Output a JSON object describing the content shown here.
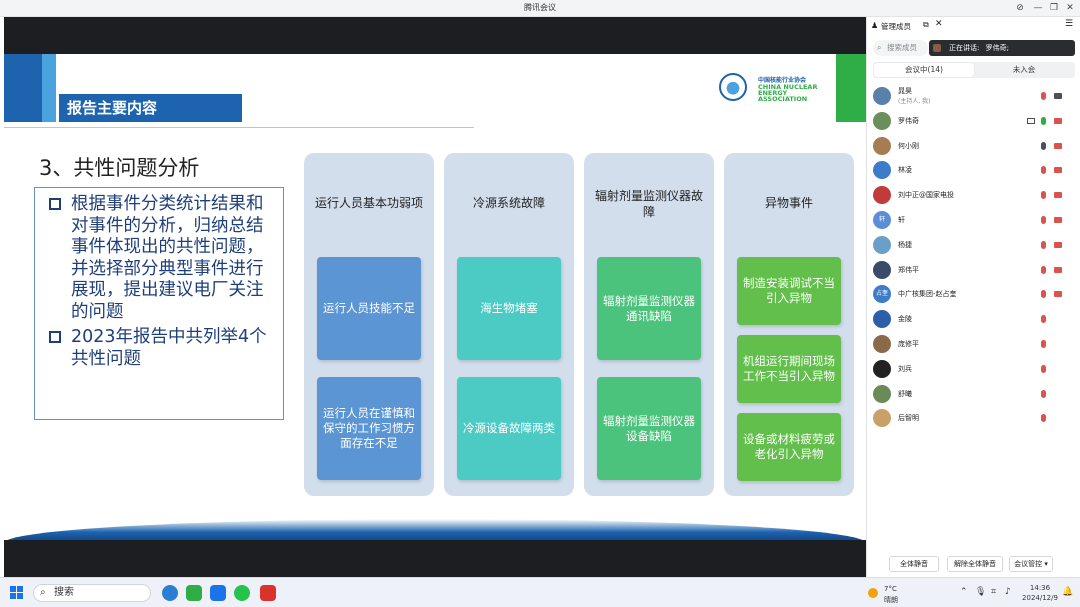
{
  "window": {
    "title": "腾讯会议"
  },
  "slide": {
    "heading": "报告主要内容",
    "logo_cn": "中国核能行业协会",
    "logo_en": "CHINA NUCLEAR ENERGY ASSOCIATION",
    "section_title": "3、共性问题分析",
    "bullets": [
      "根据事件分类统计结果和对事件的分析，归纳总结事件体现出的共性问题，并选择部分典型事件进行展现，提出建议电厂关注的问题",
      "2023年报告中共列举4个共性问题"
    ],
    "columns": [
      {
        "title": "运行人员基本功弱项",
        "cards": [
          "运行人员技能不足",
          "运行人员在谨慎和保守的工作习惯方面存在不足"
        ],
        "color": "#5b95d3"
      },
      {
        "title": "冷源系统故障",
        "cards": [
          "海生物堵塞",
          "冷源设备故障两类"
        ],
        "color": "#4ccbc4"
      },
      {
        "title": "辐射剂量监测仪器故障",
        "cards": [
          "辐射剂量监测仪器通讯缺陷",
          "辐射剂量监测仪器设备缺陷"
        ],
        "color": "#4cc37c"
      },
      {
        "title": "异物事件",
        "cards": [
          "制造安装调试不当引入异物",
          "机组运行期间现场工作不当引入异物",
          "设备或材料疲劳或老化引入异物"
        ],
        "color": "#63bf4b"
      }
    ]
  },
  "panel": {
    "title": "管理成员",
    "search_placeholder": "搜索成员",
    "speaking_label": "正在讲话:",
    "speaking_name": "罗伟奇;",
    "tabs": [
      "会议中(14)",
      "未入会"
    ],
    "members": [
      {
        "name": "晁昊",
        "sub": "(主持人, 我)",
        "avatar_color": "#5a7fa8",
        "mic": "red",
        "cam": "off"
      },
      {
        "name": "罗伟奇",
        "avatar_color": "#6b8e5a",
        "mic": "green",
        "cam": "red",
        "screen": true
      },
      {
        "name": "何小刚",
        "avatar_color": "#a67c52",
        "mic": "ok",
        "cam": "red"
      },
      {
        "name": "林凌",
        "avatar_color": "#3d7cc9",
        "mic": "red",
        "cam": "red"
      },
      {
        "name": "刘中正@国家电投",
        "avatar_color": "#c23b3b",
        "mic": "red",
        "cam": "red"
      },
      {
        "name": "轩",
        "avatar_color": "#5b8ed6",
        "avatar_text": "轩",
        "mic": "red",
        "cam": "red"
      },
      {
        "name": "杨捷",
        "avatar_color": "#6aa0c8",
        "mic": "red",
        "cam": "red"
      },
      {
        "name": "郑伟平",
        "avatar_color": "#3a4a6a",
        "mic": "red",
        "cam": "red"
      },
      {
        "name": "中广核集团-赵占奎",
        "avatar_color": "#3d7cc9",
        "avatar_text": "占奎",
        "mic": "red",
        "cam": "red"
      },
      {
        "name": "金陵",
        "avatar_color": "#2d5fa8",
        "mic": "red",
        "cam": ""
      },
      {
        "name": "庞修平",
        "avatar_color": "#8a6a4a",
        "mic": "red",
        "cam": ""
      },
      {
        "name": "刘兵",
        "avatar_color": "#222222",
        "mic": "red",
        "cam": ""
      },
      {
        "name": "舒曦",
        "avatar_color": "#6b8a5a",
        "mic": "red",
        "cam": ""
      },
      {
        "name": "后智明",
        "avatar_color": "#c9a06a",
        "mic": "red",
        "cam": ""
      }
    ],
    "buttons": [
      "全体静音",
      "解除全体静音",
      "会议管控"
    ]
  },
  "taskbar": {
    "search_label": "搜索",
    "weather_temp": "7°C",
    "weather_desc": "晴朗",
    "time": "14:36",
    "date": "2024/12/9"
  }
}
